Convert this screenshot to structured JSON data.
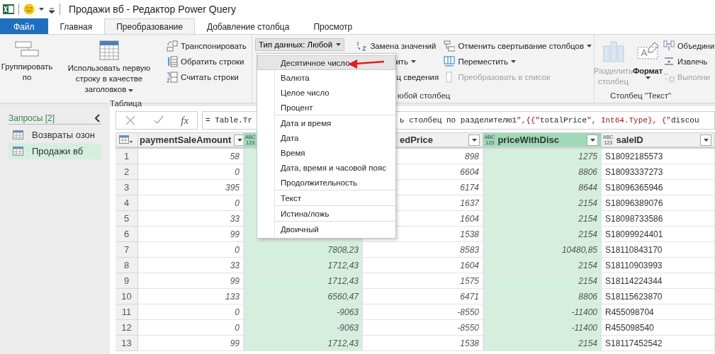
{
  "window": {
    "title": "Продажи вб - Редактор Power Query"
  },
  "tabs": [
    {
      "label": "Файл",
      "kind": "file",
      "selected": false
    },
    {
      "label": "Главная",
      "kind": "tab",
      "selected": false
    },
    {
      "label": "Преобразование",
      "kind": "tab",
      "selected": true
    },
    {
      "label": "Добавление столбца",
      "kind": "tab",
      "selected": false
    },
    {
      "label": "Просмотр",
      "kind": "tab",
      "selected": false
    }
  ],
  "ribbon": {
    "table_group": {
      "label": "Таблица",
      "group_by": "Группировать по",
      "first_row": "Использовать первую строку в качестве заголовков",
      "transpose": "Транспонировать",
      "reverse": "Обратить строки",
      "count": "Считать строки"
    },
    "any_column_group": {
      "label": "юбой столбец",
      "data_type": "Тип данных: Любой",
      "replace": "Замена значений",
      "fill": "ить",
      "pivot": "ц сведения",
      "unpivot": "Отменить свертывание столбцов",
      "move": "Переместить",
      "to_list": {
        "label": "Преобразовать в список",
        "disabled": true
      }
    },
    "text_group": {
      "label": "Столбец \"Текст\"",
      "split": {
        "label": "Разделить столбец",
        "disabled": true
      },
      "format": "Формат",
      "merge": {
        "label": "Объедини",
        "disabled": false
      },
      "extract": {
        "label": "Извлечь",
        "disabled": false
      },
      "parse": {
        "label": "Выполни",
        "disabled": true
      }
    }
  },
  "queries": {
    "title": "Запросы [2]",
    "items": [
      {
        "label": "Возвраты озон",
        "selected": false
      },
      {
        "label": "Продажи вб",
        "selected": true
      }
    ]
  },
  "formula": {
    "fx_label": "fx",
    "start": "= Table.Tr",
    "end": "ь столбец по разделителю1\",{{\"totalPrice\", Int64.Type}, {\"discou"
  },
  "table": {
    "columns": [
      {
        "label": "paymentSaleAmount",
        "selected": false
      },
      {
        "type_label": [
          "ABC",
          "123"
        ],
        "selected": true
      },
      {
        "label": "edPrice",
        "selected": false
      },
      {
        "label": "priceWithDisc",
        "type_label": [
          "ABC",
          "123"
        ],
        "selected": true
      },
      {
        "label": "saleID",
        "type_label": [
          "ABC",
          "123"
        ],
        "selected": false
      }
    ],
    "rows": [
      [
        "58",
        null,
        "898",
        "1275",
        "S18092185573"
      ],
      [
        "0",
        null,
        "6604",
        "8806",
        "S18093337273"
      ],
      [
        "395",
        null,
        "6174",
        "8644",
        "S18096365946"
      ],
      [
        "0",
        null,
        "1637",
        "2154",
        "S18096389076"
      ],
      [
        "33",
        null,
        "1604",
        "2154",
        "S18098733586"
      ],
      [
        "99",
        null,
        "1538",
        "2154",
        "S18099924401"
      ],
      [
        "0",
        "7808,23",
        "8583",
        "10480,85",
        "S18110843170"
      ],
      [
        "33",
        "1712,43",
        "1604",
        "2154",
        "S18110903993"
      ],
      [
        "99",
        "1712,43",
        "1575",
        "2154",
        "S18114224344"
      ],
      [
        "133",
        "6560,47",
        "6471",
        "8806",
        "S18115623870"
      ],
      [
        "0",
        "-9063",
        "-8550",
        "-11400",
        "R455098704"
      ],
      [
        "0",
        "-9063",
        "-8550",
        "-11400",
        "R455098540"
      ],
      [
        "99",
        "1712,43",
        "1538",
        "2154",
        "S18117452542"
      ]
    ],
    "row_numbers": [
      "1",
      "2",
      "3",
      "4",
      "5",
      "6",
      "7",
      "8",
      "9",
      "10",
      "11",
      "12",
      "13"
    ]
  },
  "menu": {
    "items": [
      {
        "label": "Десятичное число",
        "selected": true,
        "separator_before": false
      },
      {
        "label": "Валюта",
        "selected": false,
        "separator_before": false
      },
      {
        "label": "Целое число",
        "selected": false,
        "separator_before": false
      },
      {
        "label": "Процент",
        "selected": false,
        "separator_before": false
      },
      {
        "label": "Дата и время",
        "selected": false,
        "separator_before": true
      },
      {
        "label": "Дата",
        "selected": false,
        "separator_before": false
      },
      {
        "label": "Время",
        "selected": false,
        "separator_before": false
      },
      {
        "label": "Дата, время и часовой пояс",
        "selected": false,
        "separator_before": false
      },
      {
        "label": "Продолжительность",
        "selected": false,
        "separator_before": false
      },
      {
        "label": "Текст",
        "selected": false,
        "separator_before": true
      },
      {
        "label": "Истина/ложь",
        "selected": false,
        "separator_before": true
      },
      {
        "label": "Двоичный",
        "selected": false,
        "separator_before": true
      }
    ]
  }
}
